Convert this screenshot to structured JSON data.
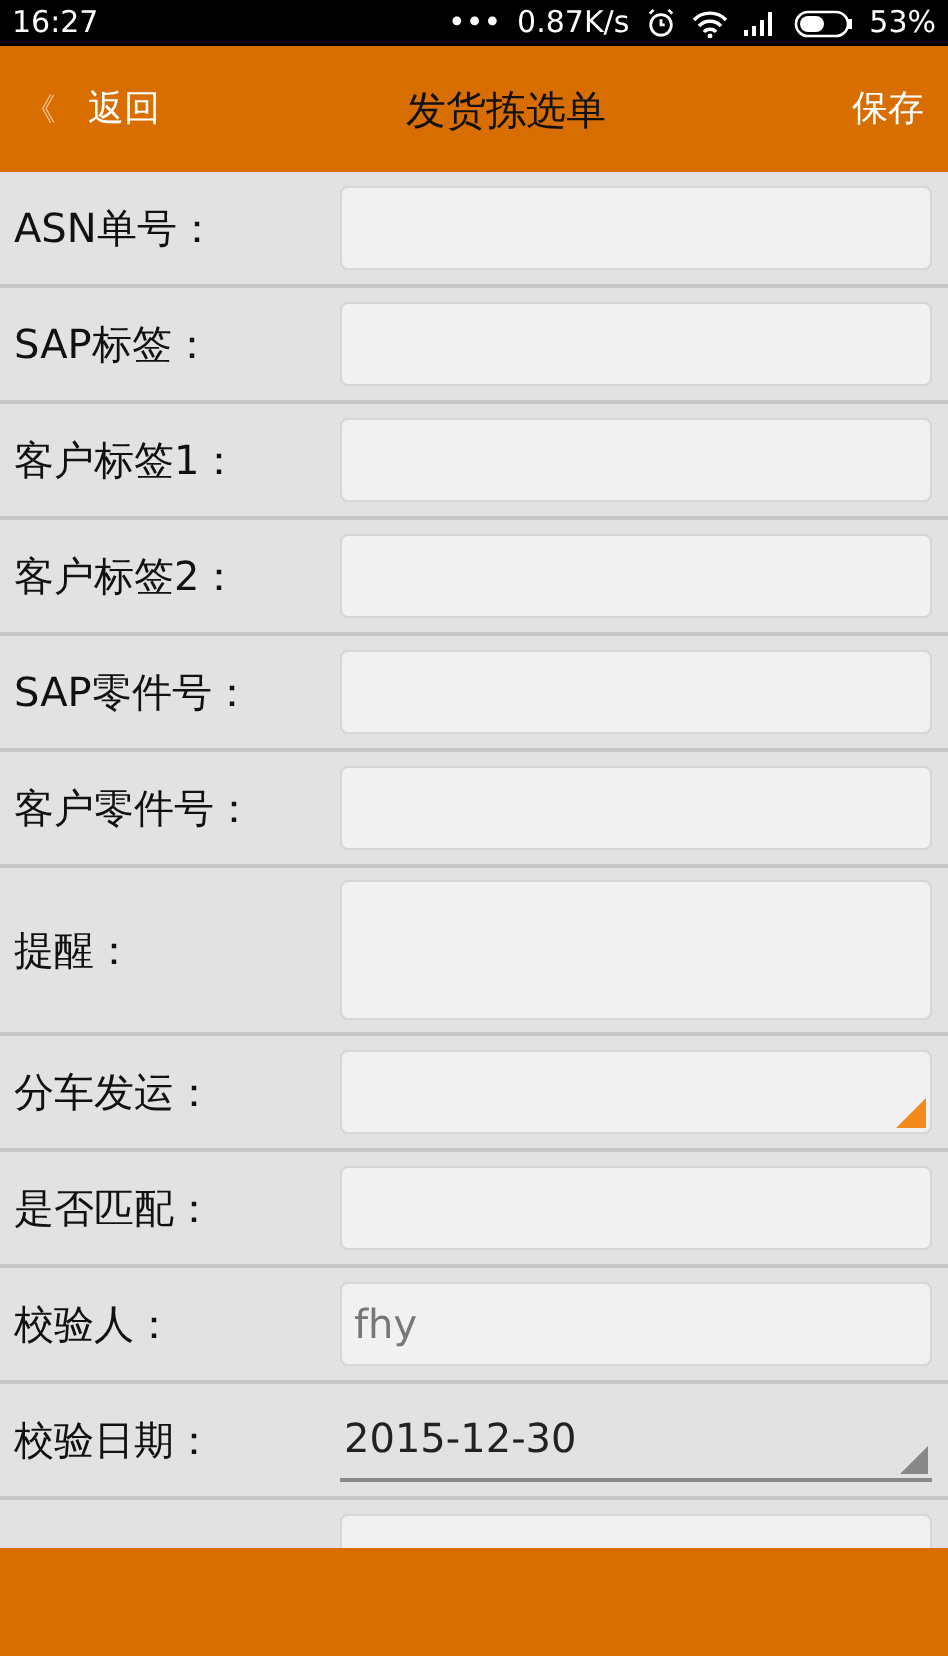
{
  "status_bar": {
    "time": "16:27",
    "more": "•••",
    "speed": "0.87K/s",
    "battery_percent": "53%"
  },
  "header": {
    "back": "返回",
    "back_glyph": "《",
    "title": "发货拣选单",
    "save": "保存"
  },
  "form": [
    {
      "kind": "text",
      "label": "ASN单号："
    },
    {
      "kind": "text",
      "label": "SAP标签："
    },
    {
      "kind": "text",
      "label": "客户标签1："
    },
    {
      "kind": "text",
      "label": "客户标签2："
    },
    {
      "kind": "text",
      "label": "SAP零件号："
    },
    {
      "kind": "text",
      "label": "客户零件号："
    },
    {
      "kind": "textarea",
      "label": "提醒："
    },
    {
      "kind": "dropdown",
      "label": "分车发运："
    },
    {
      "kind": "text",
      "label": "是否匹配："
    },
    {
      "kind": "text",
      "label": "校验人：",
      "value": "fhy",
      "disabled": true
    },
    {
      "kind": "date",
      "label": "校验日期：",
      "value": "2015-12-30"
    },
    {
      "kind": "text"
    }
  ]
}
